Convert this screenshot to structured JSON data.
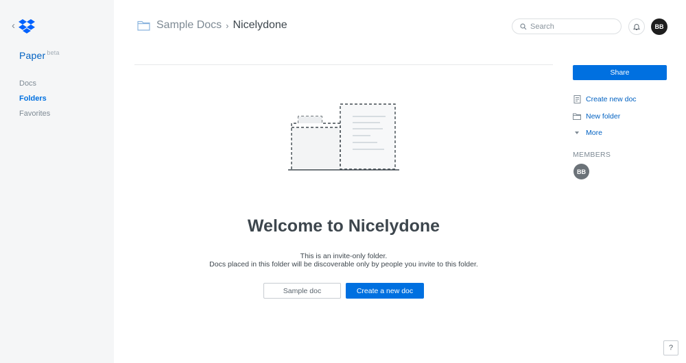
{
  "sidebar": {
    "brand": "Paper",
    "brand_tag": "beta",
    "nav": [
      {
        "label": "Docs",
        "active": false
      },
      {
        "label": "Folders",
        "active": true
      },
      {
        "label": "Favorites",
        "active": false
      }
    ]
  },
  "breadcrumb": {
    "parent": "Sample Docs",
    "current": "Nicelydone"
  },
  "header": {
    "search_placeholder": "Search",
    "avatar_initials": "BB"
  },
  "main": {
    "title": "Welcome to Nicelydone",
    "description_line1": "This is an invite-only folder.",
    "description_line2": "Docs placed in this folder will be discoverable only by people you invite to this folder.",
    "sample_doc_label": "Sample doc",
    "create_doc_label": "Create a new doc"
  },
  "right_panel": {
    "share_label": "Share",
    "actions": [
      {
        "label": "Create new doc",
        "icon": "doc-icon"
      },
      {
        "label": "New folder",
        "icon": "folder-icon"
      },
      {
        "label": "More",
        "icon": "caret-down-icon"
      }
    ],
    "members_label": "MEMBERS",
    "members": [
      {
        "initials": "BB"
      }
    ]
  },
  "help_label": "?",
  "colors": {
    "accent": "#0070e0",
    "sidebar_bg": "#f5f6f7",
    "text": "#3d464d",
    "muted": "#7e8a94"
  }
}
